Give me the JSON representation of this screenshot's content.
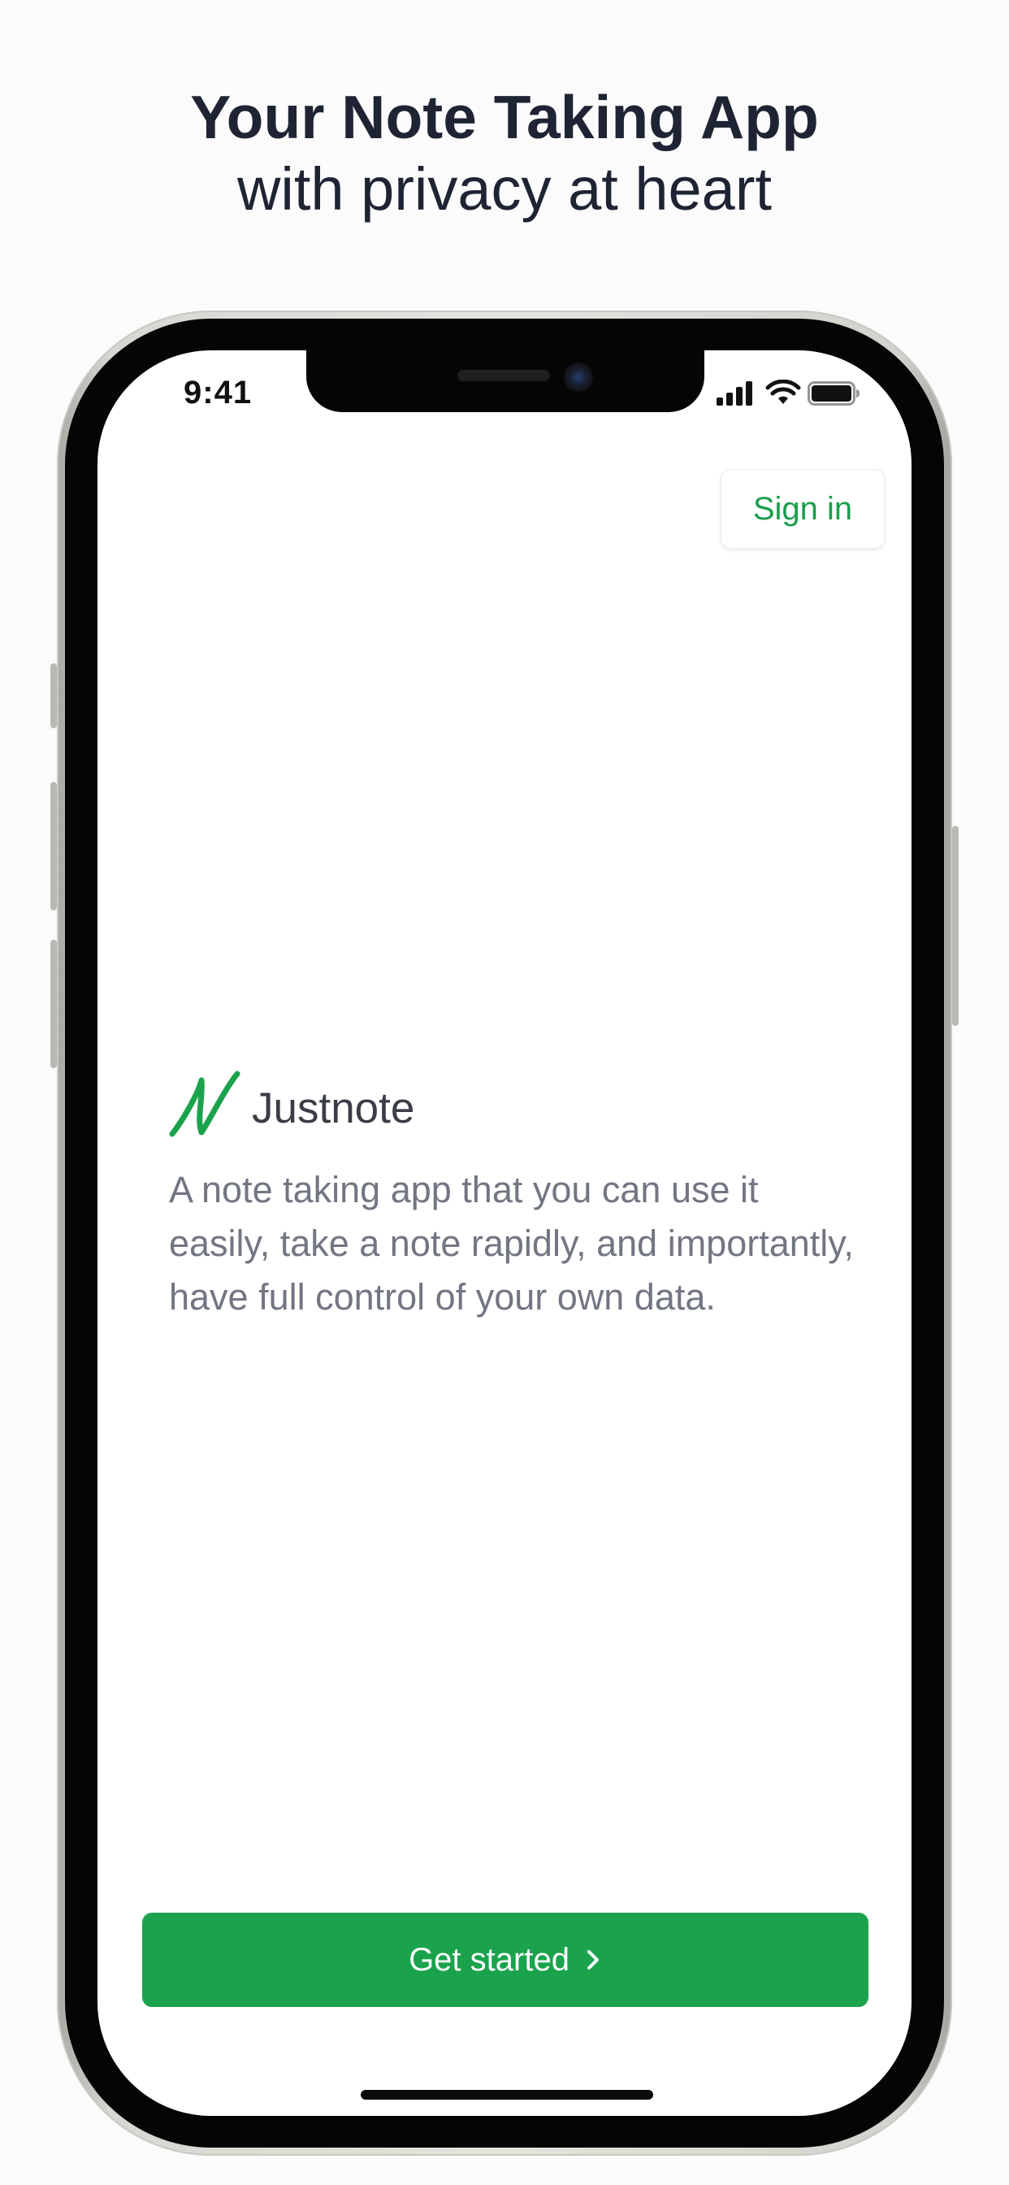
{
  "headline": {
    "title": "Your Note Taking App",
    "subtitle": "with privacy at heart"
  },
  "status_bar": {
    "time": "9:41",
    "icons": [
      "cellular-signal-icon",
      "wifi-icon",
      "battery-icon"
    ]
  },
  "header": {
    "sign_in_label": "Sign in"
  },
  "brand": {
    "logo_icon": "justnote-logo-icon",
    "name": "Justnote"
  },
  "main": {
    "description": "A note taking app that you can use it easily, take a note rapidly, and importantly, have full control of your own data."
  },
  "footer": {
    "get_started_label": "Get started",
    "chevron_icon": "chevron-right-icon"
  },
  "colors": {
    "accent": "#1aa34c",
    "heading": "#1e2433",
    "body_text": "#727683",
    "brand_text": "#3a3d45"
  }
}
